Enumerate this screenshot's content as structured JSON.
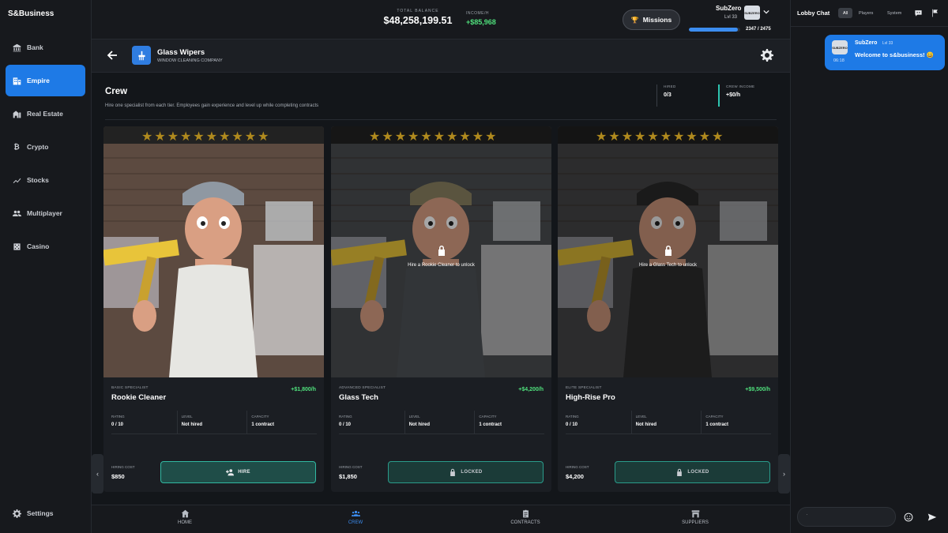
{
  "brand": "S&Business",
  "sidebar": {
    "items": [
      {
        "label": "Bank",
        "icon": "bank-icon"
      },
      {
        "label": "Empire",
        "icon": "building-icon",
        "active": true
      },
      {
        "label": "Real Estate",
        "icon": "real-estate-icon"
      },
      {
        "label": "Crypto",
        "icon": "bitcoin-icon"
      },
      {
        "label": "Stocks",
        "icon": "chart-line-icon"
      },
      {
        "label": "Multiplayer",
        "icon": "people-icon"
      },
      {
        "label": "Casino",
        "icon": "dice-icon"
      }
    ],
    "settings_label": "Settings"
  },
  "header": {
    "balance_label": "TOTAL BALANCE",
    "balance_value": "$48,258,199.51",
    "income_label": "INCOME/H",
    "income_value": "+$85,968",
    "missions_label": "Missions",
    "user_name": "SubZero",
    "user_level": "Lvl 33",
    "xp_text": "2347 / 2475",
    "xp_fraction": 0.948,
    "avatar_text": "SUBZERO"
  },
  "company": {
    "name": "Glass Wipers",
    "subtitle": "WINDOW CLEANING COMPANY"
  },
  "crew": {
    "title": "Crew",
    "description": "Hire one specialist from each tier. Employees gain experience and level up while completing contracts",
    "hired_label": "HIRED",
    "hired_value": "0/3",
    "income_label": "CREW INCOME",
    "income_value": "+$0/h"
  },
  "cards": [
    {
      "tier": "BASIC SPECIALIST",
      "name": "Rookie Cleaner",
      "income": "+$1,800/h",
      "rating_label": "RATING",
      "rating": "0 / 10",
      "level_label": "LEVEL",
      "level": "Not hired",
      "capacity_label": "CAPACITY",
      "capacity": "1 contract",
      "cost_label": "HIRING COST",
      "cost": "$850",
      "action": "HIRE",
      "locked": false,
      "lock_text": "",
      "stars": 10
    },
    {
      "tier": "ADVANCED SPECIALIST",
      "name": "Glass Tech",
      "income": "+$4,200/h",
      "rating_label": "RATING",
      "rating": "0 / 10",
      "level_label": "LEVEL",
      "level": "Not hired",
      "capacity_label": "CAPACITY",
      "capacity": "1 contract",
      "cost_label": "HIRING COST",
      "cost": "$1,850",
      "action": "LOCKED",
      "locked": true,
      "lock_text": "Hire a Rookie Cleaner to unlock",
      "stars": 10
    },
    {
      "tier": "ELITE SPECIALIST",
      "name": "High-Rise Pro",
      "income": "+$9,500/h",
      "rating_label": "RATING",
      "rating": "0 / 10",
      "level_label": "LEVEL",
      "level": "Not hired",
      "capacity_label": "CAPACITY",
      "capacity": "1 contract",
      "cost_label": "HIRING COST",
      "cost": "$4,200",
      "action": "LOCKED",
      "locked": true,
      "lock_text": "Hire a Glass Tech to unlock",
      "stars": 10
    }
  ],
  "bottom_tabs": [
    {
      "label": "HOME",
      "icon": "home-icon"
    },
    {
      "label": "CREW",
      "icon": "crew-icon",
      "active": true
    },
    {
      "label": "CONTRACTS",
      "icon": "clipboard-icon"
    },
    {
      "label": "SUPPLIERS",
      "icon": "store-icon"
    }
  ],
  "chat": {
    "title": "Lobby Chat",
    "tabs": [
      "All",
      "Players",
      "System"
    ],
    "message": {
      "user": "SubZero",
      "level": "Lvl 33",
      "time": "06:18",
      "text": "Welcome to s&business! 😀",
      "avatar_text": "SUBZERO"
    },
    "input_value": "`"
  },
  "colors": {
    "accent": "#1e7ae6",
    "positive": "#4fe07c",
    "teal": "#31b8a2",
    "star": "#b08a1e"
  }
}
